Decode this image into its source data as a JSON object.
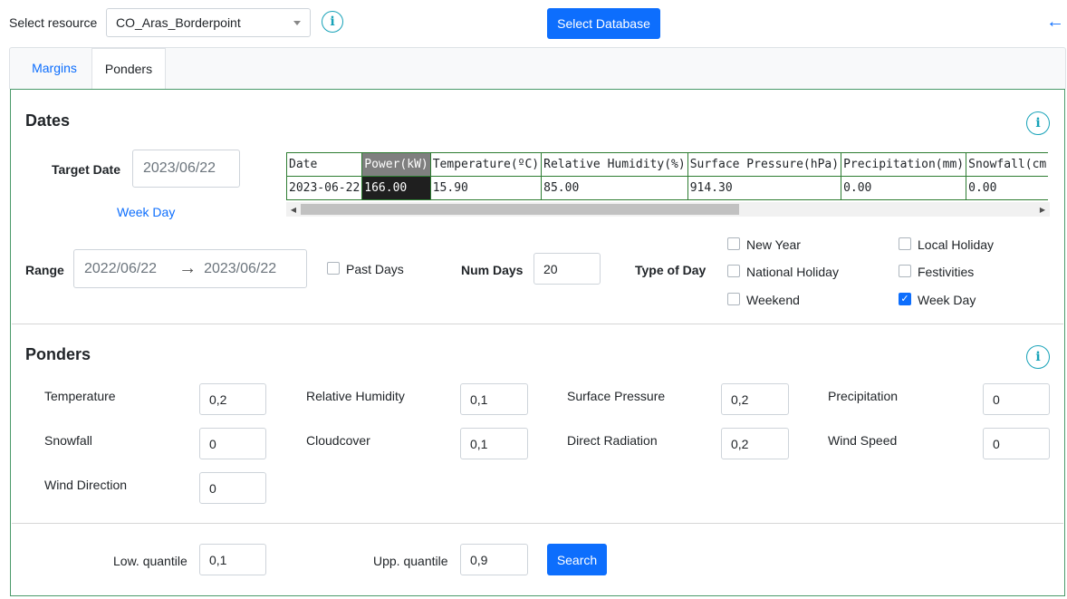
{
  "header": {
    "select_label": "Select resource",
    "resource_value": "CO_Aras_Borderpoint",
    "info_glyph": "i",
    "select_db_label": "Select Database",
    "back_glyph": "←"
  },
  "tabs": [
    {
      "label": "Margins",
      "active": false
    },
    {
      "label": "Ponders",
      "active": true
    }
  ],
  "dates": {
    "title": "Dates",
    "target_date_label": "Target Date",
    "target_date_value": "2023/06/22",
    "week_day_link": "Week Day",
    "table": {
      "columns": [
        "Date",
        "Power(kW)",
        "Temperature(ºC)",
        "Relative Humidity(%)",
        "Surface Pressure(hPa)",
        "Precipitation(mm)",
        "Snowfall(cm"
      ],
      "row": [
        "2023-06-22",
        "166.00",
        "15.90",
        "85.00",
        "914.30",
        "0.00",
        "0.00"
      ]
    },
    "range_label": "Range",
    "range_start": "2022/06/22",
    "range_arrow": "→",
    "range_end": "2023/06/22",
    "past_days_label": "Past Days",
    "past_days_checked": false,
    "num_days_label": "Num Days",
    "num_days_value": "20",
    "type_of_day_label": "Type of Day",
    "day_types": [
      {
        "label": "New Year",
        "checked": false
      },
      {
        "label": "Local Holiday",
        "checked": false
      },
      {
        "label": "National Holiday",
        "checked": false
      },
      {
        "label": "Festivities",
        "checked": false
      },
      {
        "label": "Weekend",
        "checked": false
      },
      {
        "label": "Week Day",
        "checked": true
      }
    ]
  },
  "ponders": {
    "title": "Ponders",
    "fields": [
      {
        "label": "Temperature",
        "value": "0,2"
      },
      {
        "label": "Relative Humidity",
        "value": "0,1"
      },
      {
        "label": "Surface Pressure",
        "value": "0,2"
      },
      {
        "label": "Precipitation",
        "value": "0"
      },
      {
        "label": "Snowfall",
        "value": "0"
      },
      {
        "label": "Cloudcover",
        "value": "0,1"
      },
      {
        "label": "Direct Radiation",
        "value": "0,2"
      },
      {
        "label": "Wind Speed",
        "value": "0"
      },
      {
        "label": "Wind Direction",
        "value": "0"
      }
    ]
  },
  "quantiles": {
    "low_label": "Low. quantile",
    "low_value": "0,1",
    "upp_label": "Upp. quantile",
    "upp_value": "0,9",
    "search_label": "Search"
  },
  "colors": {
    "primary": "#0d6efd",
    "info": "#17a2b8",
    "panel_border": "#4a9a6a",
    "table_border": "#2e7d32"
  },
  "icons": {
    "info": "info-circle-icon",
    "back": "arrow-left-icon",
    "dropdown": "chevron-down-icon",
    "check": "checkmark-icon"
  }
}
